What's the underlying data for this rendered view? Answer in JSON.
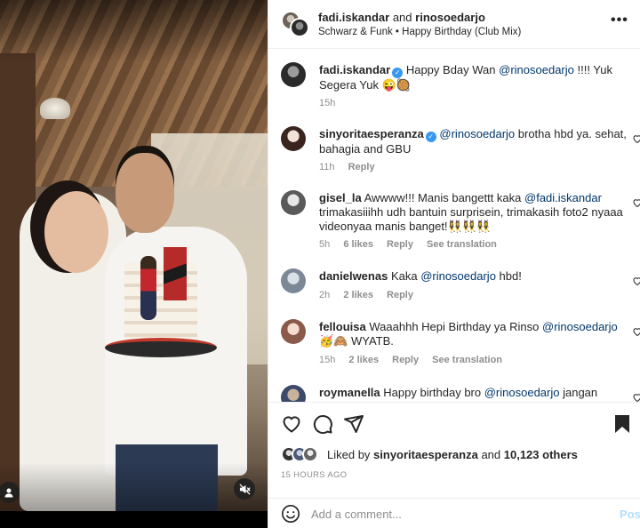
{
  "header": {
    "user1": "fadi.iskandar",
    "and_text": "and",
    "user2": "rinosoedarjo",
    "song": "Schwarz & Funk • Happy Birthday (Club Mix)",
    "more": "•••"
  },
  "caption": {
    "username": "fadi.iskandar",
    "text_pre": "Happy Bday Wan ",
    "mention": "@rinosoedarjo",
    "text_post": " !!!! Yuk Segera Yuk 😜🥘",
    "time": "15h"
  },
  "comments": [
    {
      "username": "sinyoritaesperanza",
      "mention": "@rinosoedarjo",
      "text": " brotha hbd ya. sehat, bahagia and GBU",
      "time": "11h",
      "likes": "",
      "reply": "Reply",
      "translate": ""
    },
    {
      "username": "gisel_la",
      "text_pre": "Awwww!!! Manis bangettt kaka ",
      "mention": "@fadi.iskandar",
      "text": " trimakasiiihh udh bantuin surprisein, trimakasih foto2 nyaaa videonyaa manis banget!👯‍♀️👯‍♀️👯‍♀️",
      "time": "5h",
      "likes": "6 likes",
      "reply": "Reply",
      "translate": "See translation"
    },
    {
      "username": "danielwenas",
      "text_pre": "Kaka ",
      "mention": "@rinosoedarjo",
      "text": " hbd!",
      "time": "2h",
      "likes": "2 likes",
      "reply": "Reply",
      "translate": ""
    },
    {
      "username": "fellouisa",
      "text_pre": "Waaahhh Hepi Birthday ya Rinso ",
      "mention": "@rinosoedarjo",
      "text": " 🥳🙈 WYATB.",
      "time": "15h",
      "likes": "2 likes",
      "reply": "Reply",
      "translate": "See translation"
    },
    {
      "username": "roymanella",
      "text_pre": "Happy birthday bro ",
      "mention": "@rinosoedarjo",
      "text": " jangan \"LARI-",
      "time": "",
      "likes": "",
      "reply": "",
      "translate": ""
    }
  ],
  "likes": {
    "prefix": "Liked by ",
    "user": "sinyoritaesperanza",
    "middle": " and ",
    "count": "10,123 others"
  },
  "timeago": "15 HOURS AGO",
  "add_comment": {
    "placeholder": "Add a comment...",
    "post_label": "Post"
  },
  "colors": {
    "mention": "#00376b",
    "verified": "#3897f0",
    "muted": "#8e8e8e",
    "post_disabled": "#b2dffc"
  }
}
